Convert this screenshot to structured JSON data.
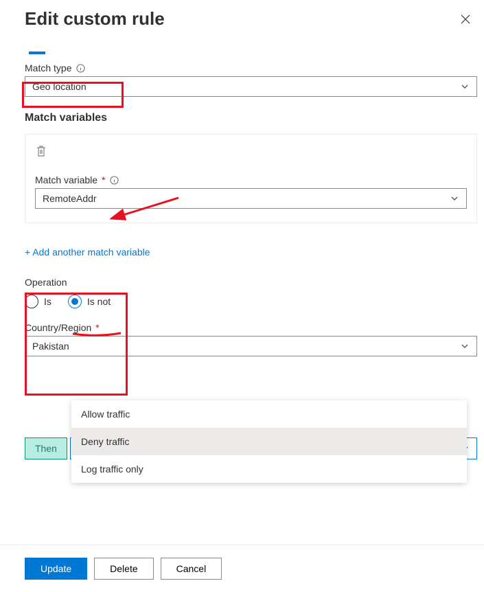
{
  "header": {
    "title": "Edit custom rule"
  },
  "matchType": {
    "label": "Match type",
    "value": "Geo location"
  },
  "matchVariables": {
    "sectionTitle": "Match variables",
    "variable": {
      "label": "Match variable",
      "value": "RemoteAddr"
    },
    "addLink": "+ Add another match variable"
  },
  "operation": {
    "label": "Operation",
    "options": {
      "is": "Is",
      "isNot": "Is not"
    },
    "selected": "isNot"
  },
  "countryRegion": {
    "label": "Country/Region",
    "value": "Pakistan"
  },
  "actionMenu": {
    "items": [
      "Allow traffic",
      "Deny traffic",
      "Log traffic only"
    ],
    "highlighted": "Deny traffic"
  },
  "then": {
    "label": "Then",
    "value": "Deny traffic"
  },
  "footer": {
    "update": "Update",
    "delete": "Delete",
    "cancel": "Cancel"
  }
}
